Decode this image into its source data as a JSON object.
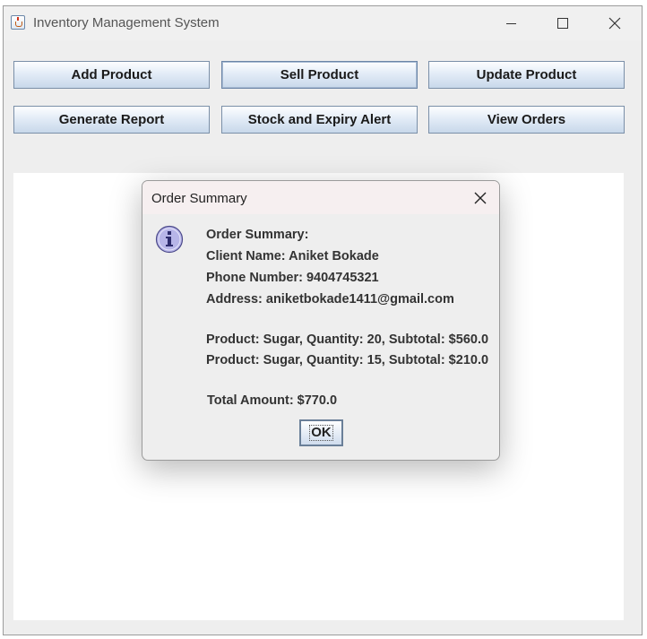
{
  "window": {
    "title": "Inventory Management System",
    "controls": {
      "minimize": "minimize",
      "maximize": "maximize",
      "close": "close"
    }
  },
  "toolbar": {
    "buttons": [
      {
        "label": "Add Product"
      },
      {
        "label": "Sell Product"
      },
      {
        "label": "Update Product"
      },
      {
        "label": "Generate Report"
      },
      {
        "label": "Stock and Expiry Alert"
      },
      {
        "label": "View Orders"
      }
    ]
  },
  "dialog": {
    "title": "Order Summary",
    "icon": "information-icon",
    "lines": [
      "Order Summary:",
      "Client Name: Aniket Bokade",
      "Phone Number: 9404745321",
      "Address: aniketbokade1411@gmail.com",
      "Product: Sugar, Quantity: 20, Subtotal: $560.0",
      "Product: Sugar, Quantity: 15, Subtotal: $210.0",
      "Total Amount: $770.0"
    ],
    "ok_label": "OK"
  },
  "colors": {
    "button_gradient_top": "#fdfeff",
    "button_gradient_bottom": "#c8d8ea",
    "dialog_titlebar": "#f6eff0",
    "info_icon_fill": "#b7b5e8"
  }
}
